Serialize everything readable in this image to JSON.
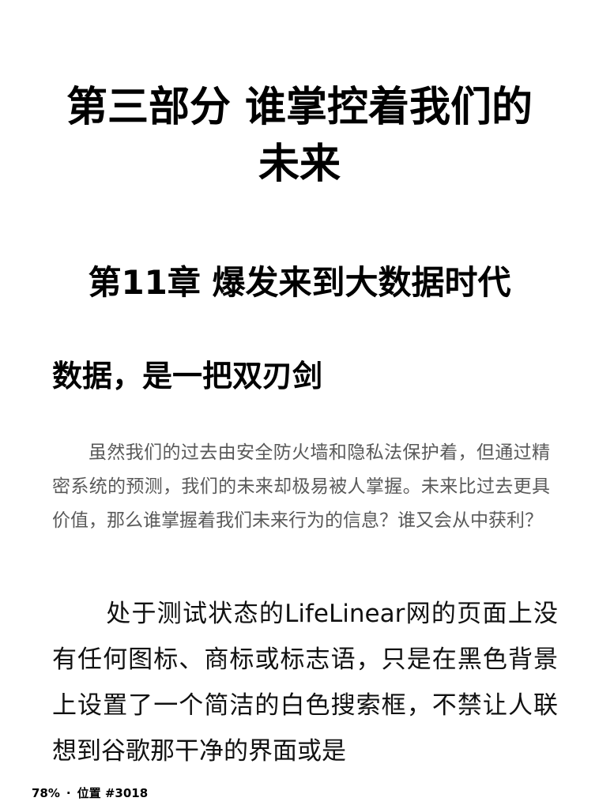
{
  "part_title": "第三部分 谁掌控着我们的未来",
  "chapter_title": "第11章 爆发来到大数据时代",
  "section_title": "数据，是一把双刃剑",
  "intro_paragraph": "虽然我们的过去由安全防火墙和隐私法保护着，但通过精密系统的预测，我们的未来却极易被人掌握。未来比过去更具价值，那么谁掌握着我们未来行为的信息？谁又会从中获利？",
  "body_paragraph": "处于测试状态的LifeLinear网的页面上没有任何图标、商标或标志语，只是在黑色背景上设置了一个简洁的白色搜索框，不禁让人联想到谷歌那干净的界面或是",
  "footer": {
    "progress": "78%",
    "separator": "·",
    "location": "位置 #3018"
  }
}
